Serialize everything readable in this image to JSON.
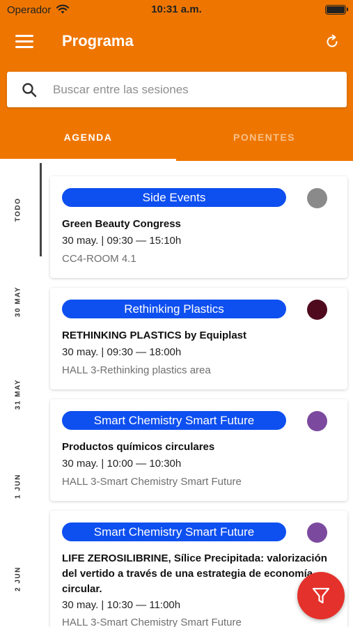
{
  "status_bar": {
    "carrier": "Operador",
    "time": "10:31 a.m."
  },
  "header": {
    "title": "Programa"
  },
  "search": {
    "placeholder": "Buscar entre las sesiones"
  },
  "tabs": [
    {
      "label": "AGENDA",
      "active": true
    },
    {
      "label": "PONENTES",
      "active": false
    }
  ],
  "date_rail": [
    "TODO",
    "30 MAY",
    "31 MAY",
    "1 JUN",
    "2 JUN"
  ],
  "sessions": [
    {
      "track": "Side Events",
      "track_color": "#8a8a8a",
      "title": "Green Beauty Congress",
      "time": "30 may. | 09:30 — 15:10h",
      "room": "CC4-ROOM 4.1"
    },
    {
      "track": "Rethinking Plastics",
      "track_color": "#4f0a1e",
      "title": "RETHINKING PLASTICS by Equiplast",
      "time": "30 may. | 09:30 — 18:00h",
      "room": "HALL 3-Rethinking plastics area"
    },
    {
      "track": "Smart Chemistry Smart Future",
      "track_color": "#7b4a9e",
      "title": "Productos químicos circulares",
      "time": "30 may. | 10:00 — 10:30h",
      "room": "HALL 3-Smart Chemistry Smart Future"
    },
    {
      "track": "Smart Chemistry Smart Future",
      "track_color": "#7b4a9e",
      "title": "LIFE ZEROSILIBRINE, Sílice Precipitada: valorización del vertido a través de una estrategia de economía circular.",
      "time": "30 may. | 10:30 — 11:00h",
      "room": "HALL 3-Smart Chemistry Smart Future"
    }
  ],
  "colors": {
    "accent": "#ee7600",
    "pill": "#0e4ff0",
    "fab": "#e4312b"
  },
  "icons": {
    "menu": "hamburger-icon",
    "refresh": "refresh-icon",
    "search": "search-icon",
    "filter": "filter-icon"
  }
}
